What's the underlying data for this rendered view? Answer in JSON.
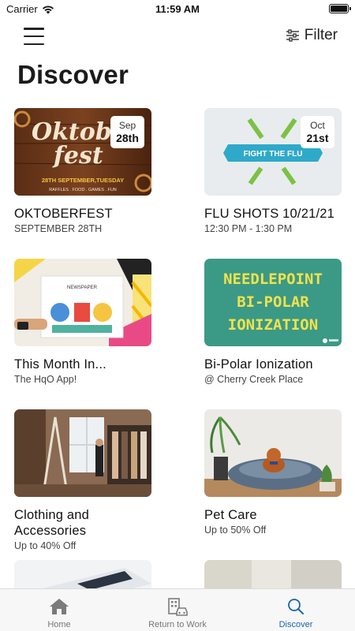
{
  "status_bar": {
    "carrier": "Carrier",
    "time": "11:59 AM"
  },
  "nav": {
    "filter_label": "Filter"
  },
  "page_title": "Discover",
  "cards": [
    {
      "title": "OKTOBERFEST",
      "subtitle": "SEPTEMBER 28TH",
      "badge_month": "Sep",
      "badge_day": "28th",
      "image_text": {
        "line1": "Oktob",
        "line2": "fest",
        "date": "28TH SEPTEMBER,TUESDAY",
        "details": "RAFFLES . FOOD . GAMES . FUN"
      }
    },
    {
      "title": "FLU SHOTS 10/21/21",
      "subtitle": "12:30 PM - 1:30 PM",
      "badge_month": "Oct",
      "badge_day": "21st",
      "image_text": {
        "banner": "FIGHT THE FLU"
      }
    },
    {
      "title": "This Month In...",
      "subtitle": "The HqO App!",
      "image_text": {
        "paper": "NEWSPAPER"
      }
    },
    {
      "title": "Bi-Polar Ionization",
      "subtitle": "@ Cherry Creek Place",
      "image_text": {
        "line1": "NEEDLEPOINT",
        "line2": "BI-POLAR",
        "line3": "IONIZATION"
      }
    },
    {
      "title": "Clothing and Accessories",
      "subtitle": "Up to 40% Off"
    },
    {
      "title": "Pet Care",
      "subtitle": "Up to 50% Off"
    },
    {
      "title": "",
      "subtitle": ""
    },
    {
      "title": "",
      "subtitle": ""
    }
  ],
  "tabs": [
    {
      "label": "Home",
      "icon": "home-icon"
    },
    {
      "label": "Return to Work",
      "icon": "building-car-icon"
    },
    {
      "label": "Discover",
      "icon": "search-icon"
    }
  ],
  "colors": {
    "accent": "#1c65a8",
    "tab_bar_bg": "#f7f7f7",
    "needlepoint_bg": "#3a9a86",
    "needlepoint_text": "#f4e14c"
  }
}
